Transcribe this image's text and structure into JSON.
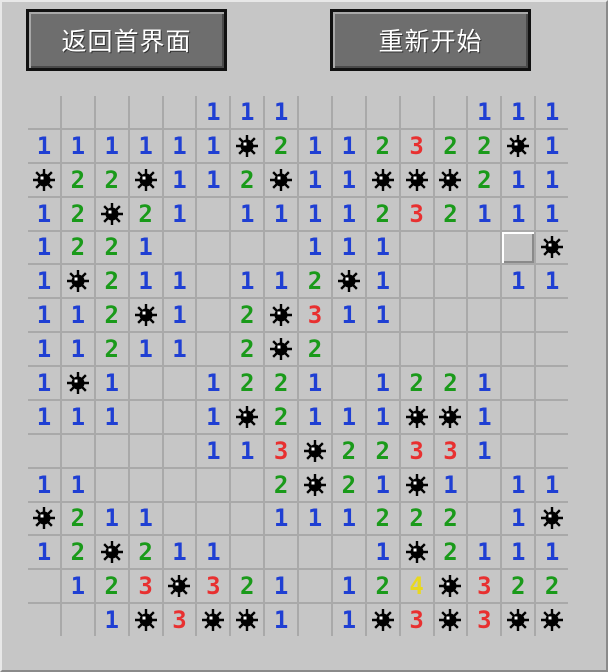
{
  "buttons": {
    "back_label": "返回首界面",
    "restart_label": "重新开始"
  },
  "colors": {
    "one": "#1f3fd3",
    "two": "#1a9a1a",
    "three": "#e83030",
    "four": "#e8d820",
    "mine": "#000000"
  },
  "board": {
    "rows": [
      "     111    111 ",
      "111111*211232 2*1",
      "*22*112*11***211",
      "12*21 111123 2111",
      "122 1    111   C*",
      "1*211 112*1    11",
      "112*1 2*311      ",
      "11211 2*2        ",
      "1*1  1221 1221   ",
      "111  1*2111**1   ",
      "     113*2233 1  ",
      "11      2*21*1 11",
      "*211    111222 1*",
      "12*211     1*2111",
      " 123*321 12 4*322",
      "  1*3***1 1*3*3**"
    ]
  }
}
